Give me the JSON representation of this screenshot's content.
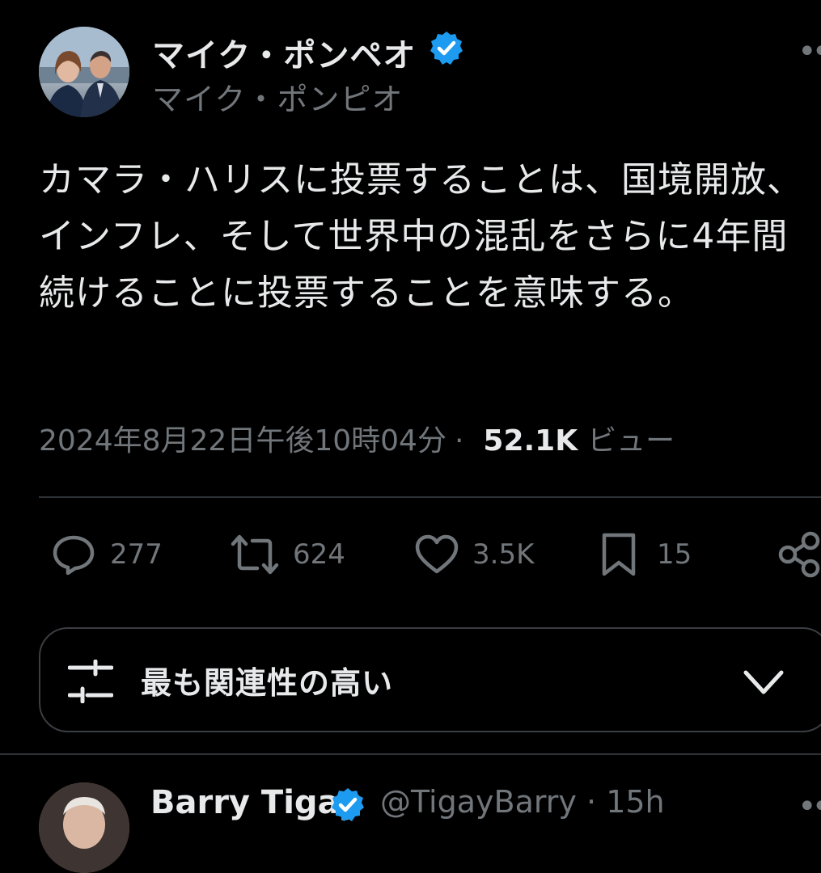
{
  "colors": {
    "background": "#000000",
    "text_primary": "#e7e9ea",
    "text_secondary": "#71767b",
    "verified": "#1d9bf0",
    "divider": "#2f3336"
  },
  "tweet": {
    "display_name": "マイク・ポンペオ",
    "handle": "マイク・ポンピオ",
    "verified_icon": "verified-badge-icon",
    "more_icon": "more-dots-icon",
    "text": "カマラ・ハリスに投票することは、国境開放、インフレ、そして世界中の混乱をさらに4年間続けることに投票することを意味する。",
    "timestamp": "2024年8月22日午後10時04分",
    "separator": "·",
    "views_count": "52.1K",
    "views_label": "ビュー"
  },
  "actions": {
    "replies": {
      "icon": "reply-icon",
      "count": "277"
    },
    "retweets": {
      "icon": "retweet-icon",
      "count": "624"
    },
    "likes": {
      "icon": "heart-icon",
      "count": "3.5K"
    },
    "bookmarks": {
      "icon": "bookmark-icon",
      "count": "15"
    },
    "share": {
      "icon": "share-icon"
    }
  },
  "sort": {
    "icon": "filter-sliders-icon",
    "label": "最も関連性の高い",
    "chevron_icon": "chevron-down-icon"
  },
  "reply_preview": {
    "display_name": "Barry Tigay",
    "handle": "@TigayBarry",
    "separator": "·",
    "time": "15h"
  }
}
